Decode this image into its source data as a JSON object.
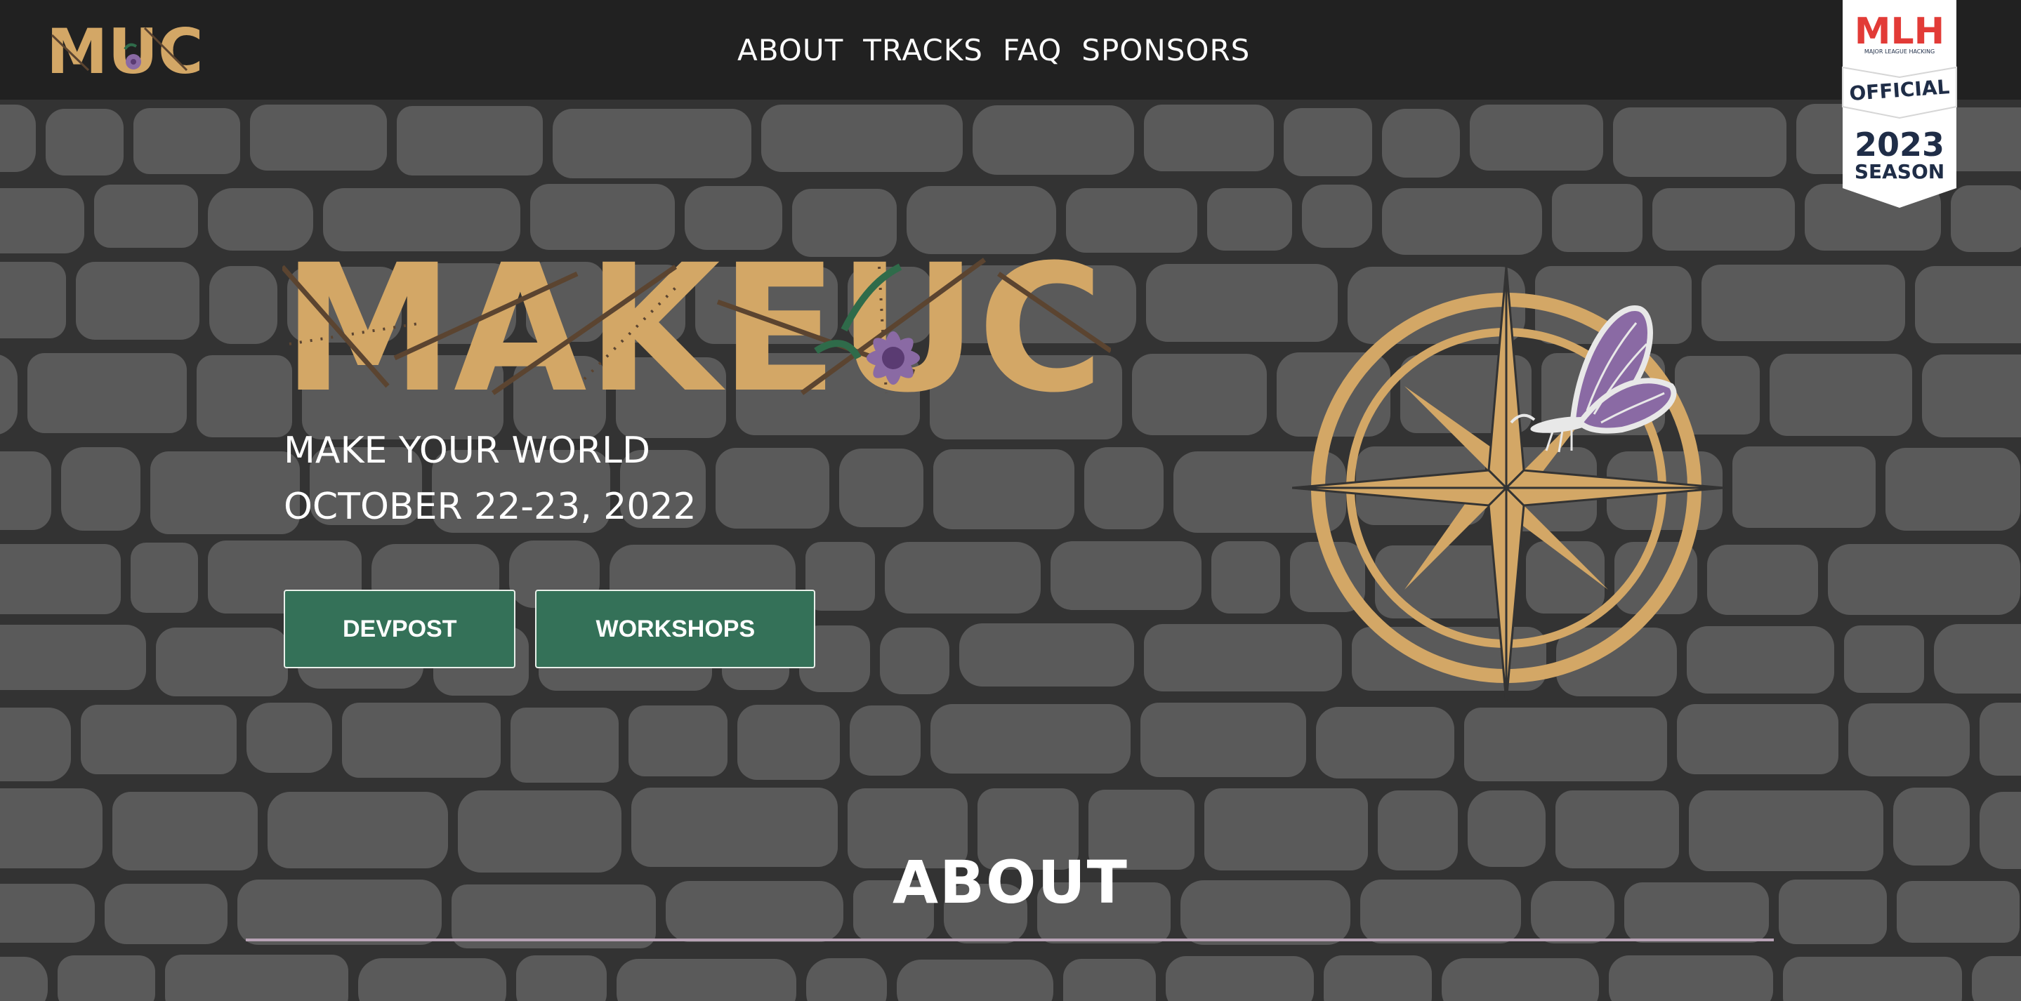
{
  "header": {
    "logo_text": "MUC",
    "nav": [
      {
        "label": "ABOUT"
      },
      {
        "label": "TRACKS"
      },
      {
        "label": "FAQ"
      },
      {
        "label": "SPONSORS"
      }
    ]
  },
  "mlh_badge": {
    "logo": "MLH",
    "org": "MAJOR LEAGUE HACKING",
    "official": "OFFICIAL",
    "year": "2023",
    "season": "SEASON"
  },
  "hero": {
    "title": "MAKEUC",
    "tagline_line1": "MAKE YOUR WORLD",
    "tagline_line2": "OCTOBER 22-23, 2022",
    "buttons": [
      {
        "label": "DEVPOST"
      },
      {
        "label": "WORKSHOPS"
      }
    ],
    "illustration": "compass-with-butterfly"
  },
  "about": {
    "heading": "ABOUT"
  },
  "colors": {
    "header_bg": "#212121",
    "stone": "#5a5a5a",
    "mortar": "#333333",
    "gold": "#d3a766",
    "button_green": "#347158",
    "lavender": "#8b6ba3",
    "rule": "#b8a3b6"
  }
}
